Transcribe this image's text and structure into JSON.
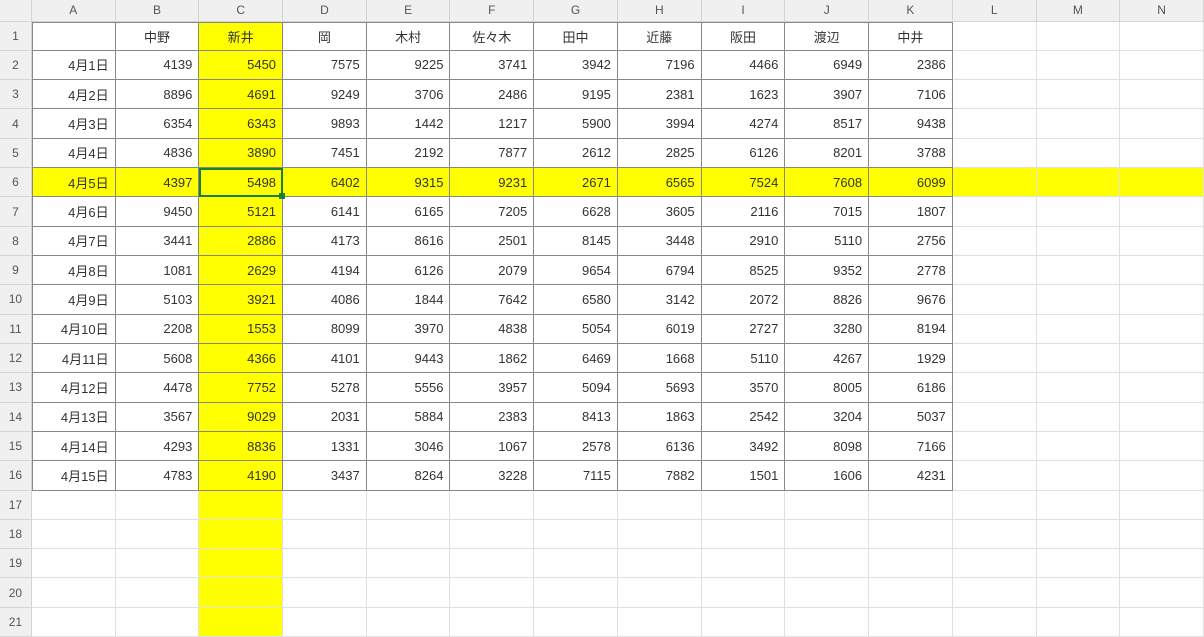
{
  "columns": [
    "A",
    "B",
    "C",
    "D",
    "E",
    "F",
    "G",
    "H",
    "I",
    "J",
    "K",
    "L",
    "M",
    "N"
  ],
  "row_headers": [
    1,
    2,
    3,
    4,
    5,
    6,
    7,
    8,
    9,
    10,
    11,
    12,
    13,
    14,
    15,
    16,
    17,
    18,
    19,
    20,
    21
  ],
  "header_row": {
    "A": "",
    "B": "中野",
    "C": "新井",
    "D": "岡",
    "E": "木村",
    "F": "佐々木",
    "G": "田中",
    "H": "近藤",
    "I": "阪田",
    "J": "渡辺",
    "K": "中井"
  },
  "data_rows": [
    {
      "date": "4月1日",
      "vals": [
        4139,
        5450,
        7575,
        9225,
        3741,
        3942,
        7196,
        4466,
        6949,
        2386
      ]
    },
    {
      "date": "4月2日",
      "vals": [
        8896,
        4691,
        9249,
        3706,
        2486,
        9195,
        2381,
        1623,
        3907,
        7106
      ]
    },
    {
      "date": "4月3日",
      "vals": [
        6354,
        6343,
        9893,
        1442,
        1217,
        5900,
        3994,
        4274,
        8517,
        9438
      ]
    },
    {
      "date": "4月4日",
      "vals": [
        4836,
        3890,
        7451,
        2192,
        7877,
        2612,
        2825,
        6126,
        8201,
        3788
      ]
    },
    {
      "date": "4月5日",
      "vals": [
        4397,
        5498,
        6402,
        9315,
        9231,
        2671,
        6565,
        7524,
        7608,
        6099
      ]
    },
    {
      "date": "4月6日",
      "vals": [
        9450,
        5121,
        6141,
        6165,
        7205,
        6628,
        3605,
        2116,
        7015,
        1807
      ]
    },
    {
      "date": "4月7日",
      "vals": [
        3441,
        2886,
        4173,
        8616,
        2501,
        8145,
        3448,
        2910,
        5110,
        2756
      ]
    },
    {
      "date": "4月8日",
      "vals": [
        1081,
        2629,
        4194,
        6126,
        2079,
        9654,
        6794,
        8525,
        9352,
        2778
      ]
    },
    {
      "date": "4月9日",
      "vals": [
        5103,
        3921,
        4086,
        1844,
        7642,
        6580,
        3142,
        2072,
        8826,
        9676
      ]
    },
    {
      "date": "4月10日",
      "vals": [
        2208,
        1553,
        8099,
        3970,
        4838,
        5054,
        6019,
        2727,
        3280,
        8194
      ]
    },
    {
      "date": "4月11日",
      "vals": [
        5608,
        4366,
        4101,
        9443,
        1862,
        6469,
        1668,
        5110,
        4267,
        1929
      ]
    },
    {
      "date": "4月12日",
      "vals": [
        4478,
        7752,
        5278,
        5556,
        3957,
        5094,
        5693,
        3570,
        8005,
        6186
      ]
    },
    {
      "date": "4月13日",
      "vals": [
        3567,
        9029,
        2031,
        5884,
        2383,
        8413,
        1863,
        2542,
        3204,
        5037
      ]
    },
    {
      "date": "4月14日",
      "vals": [
        4293,
        8836,
        1331,
        3046,
        1067,
        2578,
        6136,
        3492,
        8098,
        7166
      ]
    },
    {
      "date": "4月15日",
      "vals": [
        4783,
        4190,
        3437,
        8264,
        3228,
        7115,
        7882,
        1501,
        1606,
        4231
      ]
    }
  ],
  "highlight": {
    "column_index": 2,
    "row_index": 5
  },
  "active_cell": {
    "col": 2,
    "row": 5
  },
  "data_extent": {
    "cols": 11,
    "rows": 16
  }
}
